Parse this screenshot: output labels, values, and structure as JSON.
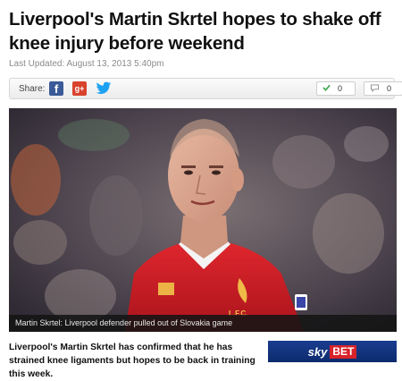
{
  "article": {
    "headline": "Liverpool's Martin Skrtel hopes to shake off knee injury before weekend",
    "last_updated": "Last Updated: August 13, 2013 5:40pm",
    "lede": "Liverpool's Martin Skrtel has confirmed that he has strained knee ligaments but hopes to be back in training this week."
  },
  "share": {
    "label": "Share:",
    "services": [
      {
        "name": "facebook",
        "glyph": "f",
        "icon": "facebook-icon",
        "color": "#3b5b98"
      },
      {
        "name": "google-plus",
        "glyph": "g+",
        "icon": "google-plus-icon",
        "color": "#d8432e"
      },
      {
        "name": "twitter",
        "icon": "twitter-bird-icon",
        "color": "#1da1f2"
      }
    ],
    "likes": "0",
    "comments": "0"
  },
  "hero": {
    "caption": "Martin Skrtel: Liverpool defender pulled out of Slovakia game",
    "crest_text": "L.F.C."
  },
  "ad": {
    "brand_first": "sky",
    "brand_second": "BET",
    "colors": {
      "background": "#0c2a6d",
      "accent": "#d8232a"
    }
  }
}
